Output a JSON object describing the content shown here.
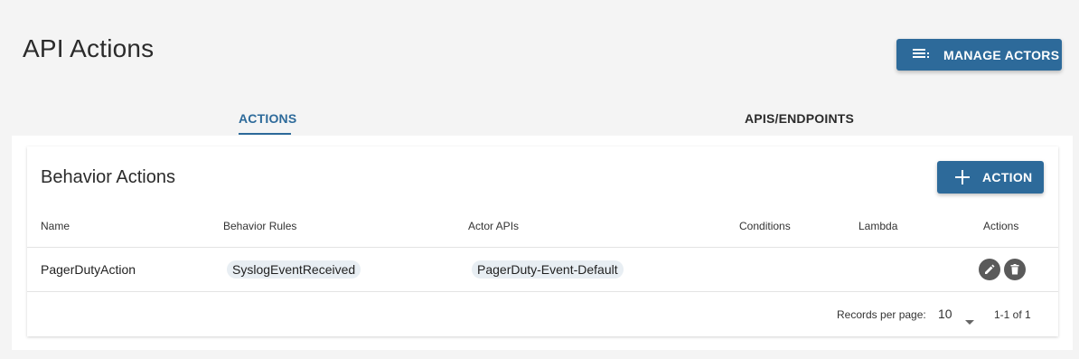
{
  "page": {
    "title": "API Actions"
  },
  "header": {
    "manage_actors_label": "MANAGE ACTORS"
  },
  "tabs": [
    {
      "label": "ACTIONS",
      "active": true
    },
    {
      "label": "APIS/ENDPOINTS",
      "active": false
    }
  ],
  "card": {
    "title": "Behavior Actions",
    "add_action_label": "ACTION"
  },
  "table": {
    "columns": [
      "Name",
      "Behavior Rules",
      "Actor APIs",
      "Conditions",
      "Lambda",
      "Actions"
    ],
    "rows": [
      {
        "name": "PagerDutyAction",
        "behavior_rule": "SyslogEventReceived",
        "actor_api": "PagerDuty-Event-Default",
        "conditions": "",
        "lambda": ""
      }
    ]
  },
  "pagination": {
    "records_per_page_label": "Records per page:",
    "records_per_page_value": "10",
    "range_text": "1-1 of 1"
  },
  "icons": {
    "manage": "list-menu-icon",
    "add": "plus-icon",
    "edit": "pencil-icon",
    "delete": "trash-icon",
    "dropdown": "caret-down-icon"
  },
  "colors": {
    "accent": "#2d6a9a",
    "background": "#f4f4f4",
    "chip": "#e8eef3",
    "icon_button": "#5a5a5a"
  }
}
